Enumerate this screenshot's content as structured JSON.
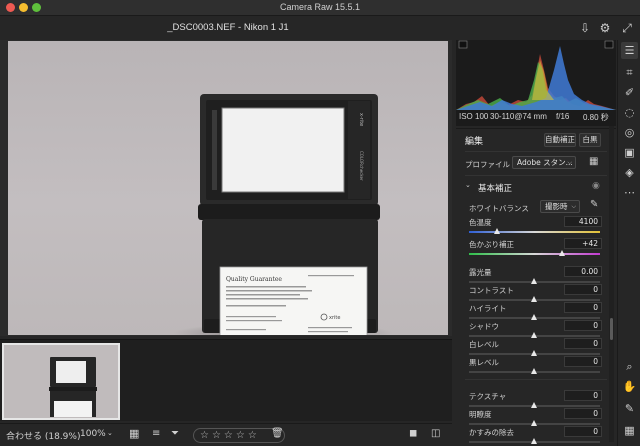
{
  "window": {
    "title": "Camera Raw 15.5.1"
  },
  "header": {
    "file_title": "_DSC0003.NEF  -  Nikon 1 J1"
  },
  "photo": {
    "card": {
      "brand": "x-rite",
      "side_text": "COLORchecker",
      "doc_title": "Quality Guarantee",
      "doc_body": "X-Rite, Inc. certifies that this ColorChecker Passport meets or exceeds all specifications and requirements.",
      "doc_footer": "Munsell Color Services is a Division of X-Rite.",
      "doc_logo": "xrite"
    }
  },
  "histogram": {
    "iso": "ISO 100",
    "lens": "30-110@74 mm",
    "aperture": "f/16",
    "shutter": "0.80 秒"
  },
  "panel": {
    "edit_title": "編集",
    "auto_button": "自動補正",
    "bw_button": "白黒",
    "profile_label": "プロファイル",
    "profile_value": "Adobe スタン...",
    "basic_title": "基本補正",
    "wb_label": "ホワイトバランス",
    "wb_value": "撮影時",
    "sliders": [
      {
        "label": "色温度",
        "value": "4100",
        "pos": 0.22
      },
      {
        "label": "色かぶり補正",
        "value": "+42",
        "pos": 0.71
      },
      {
        "label": "露光量",
        "value": "0.00",
        "pos": 0.5
      },
      {
        "label": "コントラスト",
        "value": "0",
        "pos": 0.5
      },
      {
        "label": "ハイライト",
        "value": "0",
        "pos": 0.5
      },
      {
        "label": "シャドウ",
        "value": "0",
        "pos": 0.5
      },
      {
        "label": "白レベル",
        "value": "0",
        "pos": 0.5
      },
      {
        "label": "黒レベル",
        "value": "0",
        "pos": 0.5
      },
      {
        "label": "テクスチャ",
        "value": "0",
        "pos": 0.5
      },
      {
        "label": "明瞭度",
        "value": "0",
        "pos": 0.5
      },
      {
        "label": "かすみの除去",
        "value": "0",
        "pos": 0.5
      }
    ]
  },
  "bottombar": {
    "fit_label": "合わせる (18.9%)",
    "zoom_label": "100%",
    "stars": "☆☆☆☆☆"
  },
  "colors": {
    "accent": "#4a90e2",
    "background": "#262626"
  }
}
